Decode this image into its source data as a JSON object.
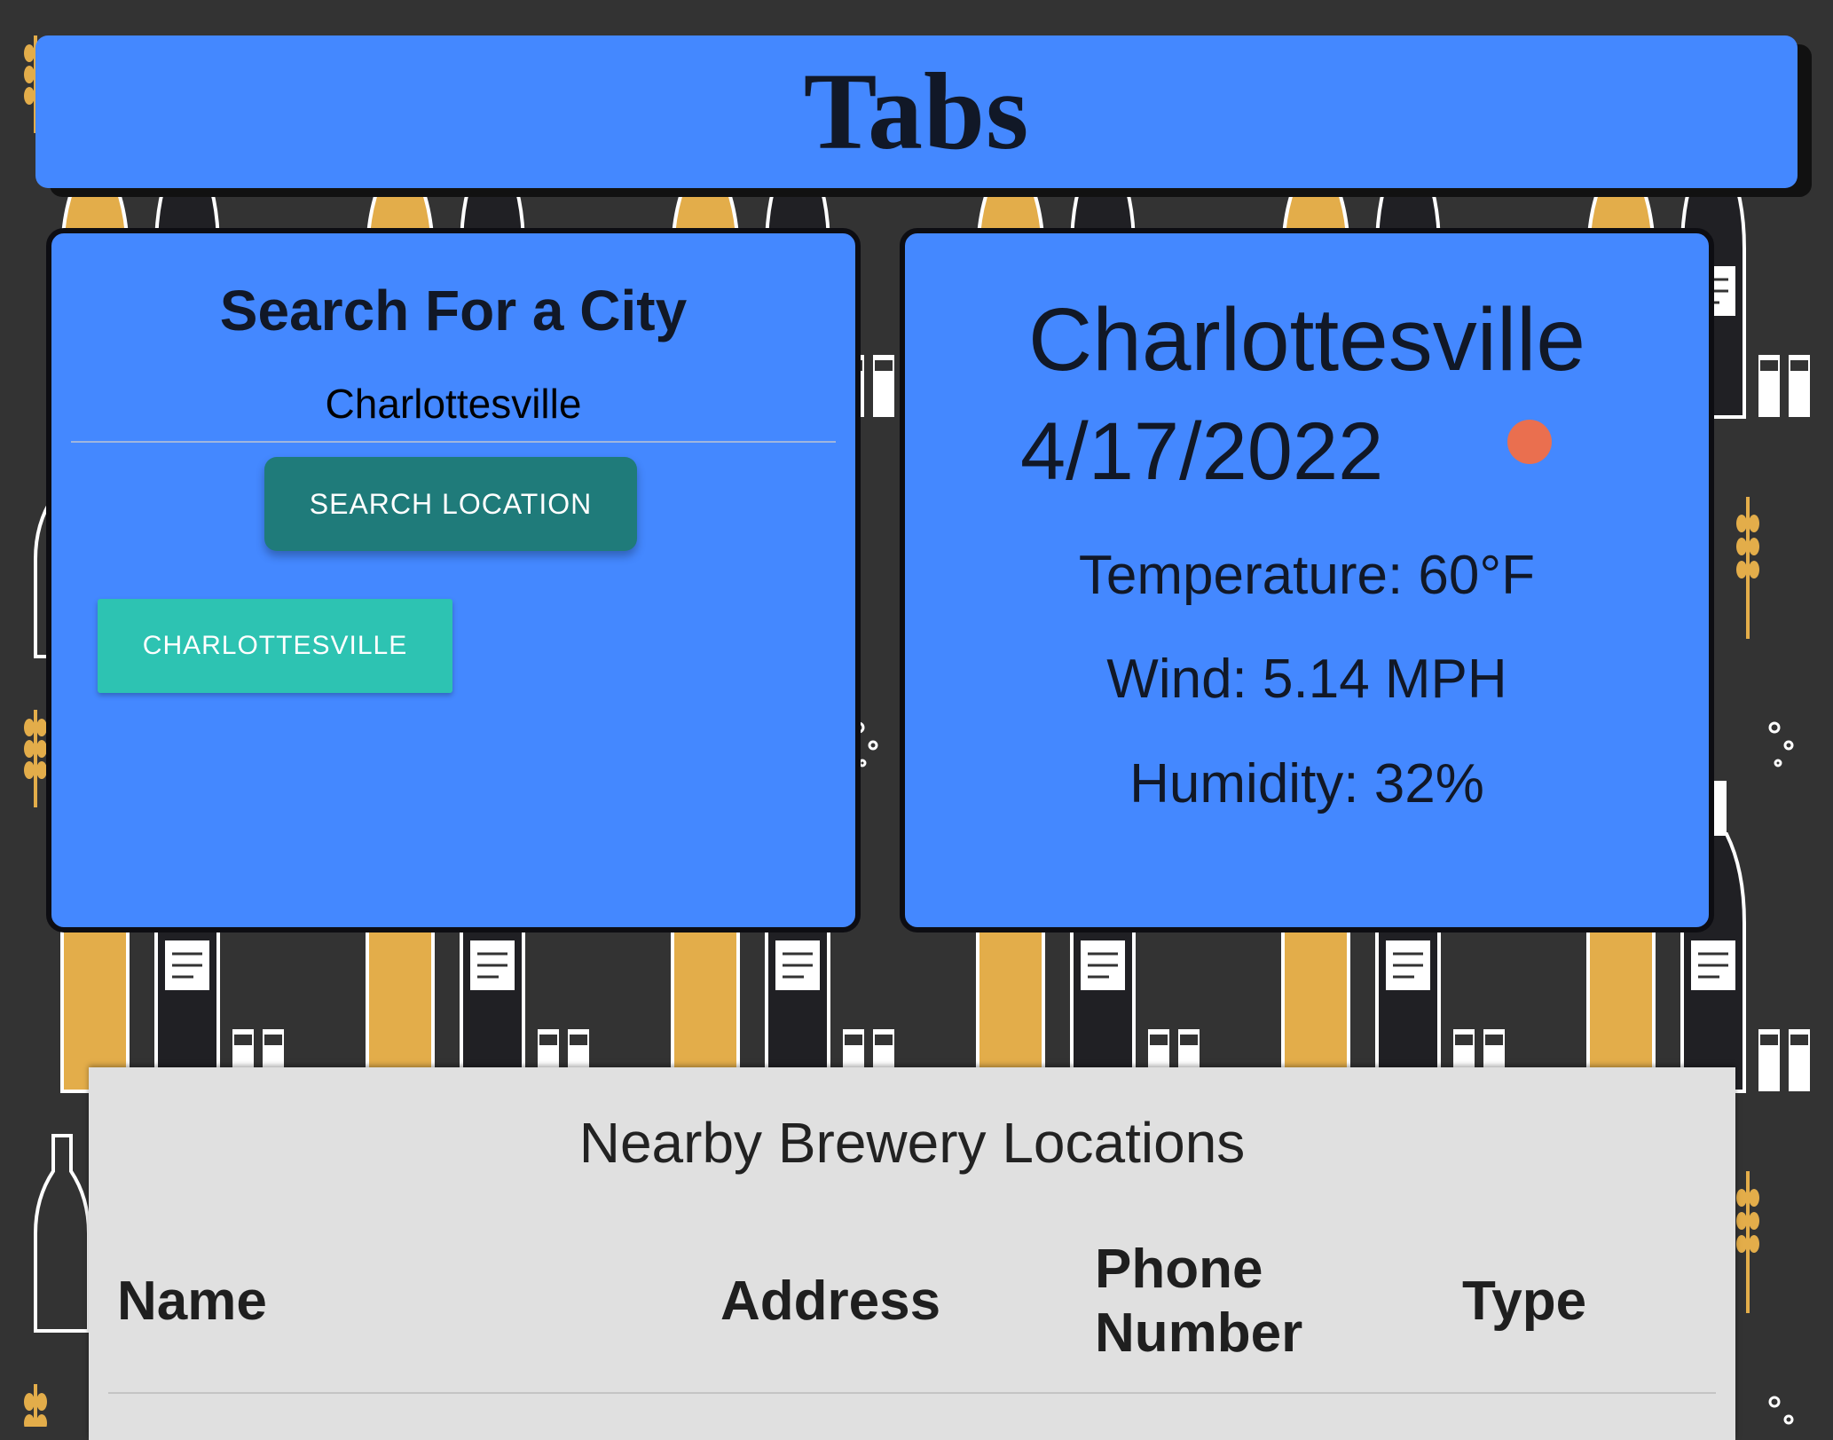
{
  "header": {
    "title": "Tabs"
  },
  "search": {
    "title": "Search For a City",
    "input_value": "Charlottesville",
    "button_label": "SEARCH LOCATION",
    "history": [
      "CHARLOTTESVILLE"
    ]
  },
  "weather": {
    "city": "Charlottesville",
    "date": "4/17/2022",
    "temperature": "Temperature: 60°F",
    "wind": "Wind: 5.14 MPH",
    "humidity": "Humidity: 32%",
    "icon": "weather-dot-icon",
    "icon_color": "#ea6f4f"
  },
  "brewery": {
    "title": "Nearby Brewery Locations",
    "columns": [
      "Name",
      "Address",
      "Phone Number",
      "Type"
    ]
  },
  "colors": {
    "accent": "#4488ff",
    "search_button": "#1f7b7a",
    "history_button": "#2dc3b2",
    "background": "#333333",
    "panel": "#e0e0e0"
  }
}
